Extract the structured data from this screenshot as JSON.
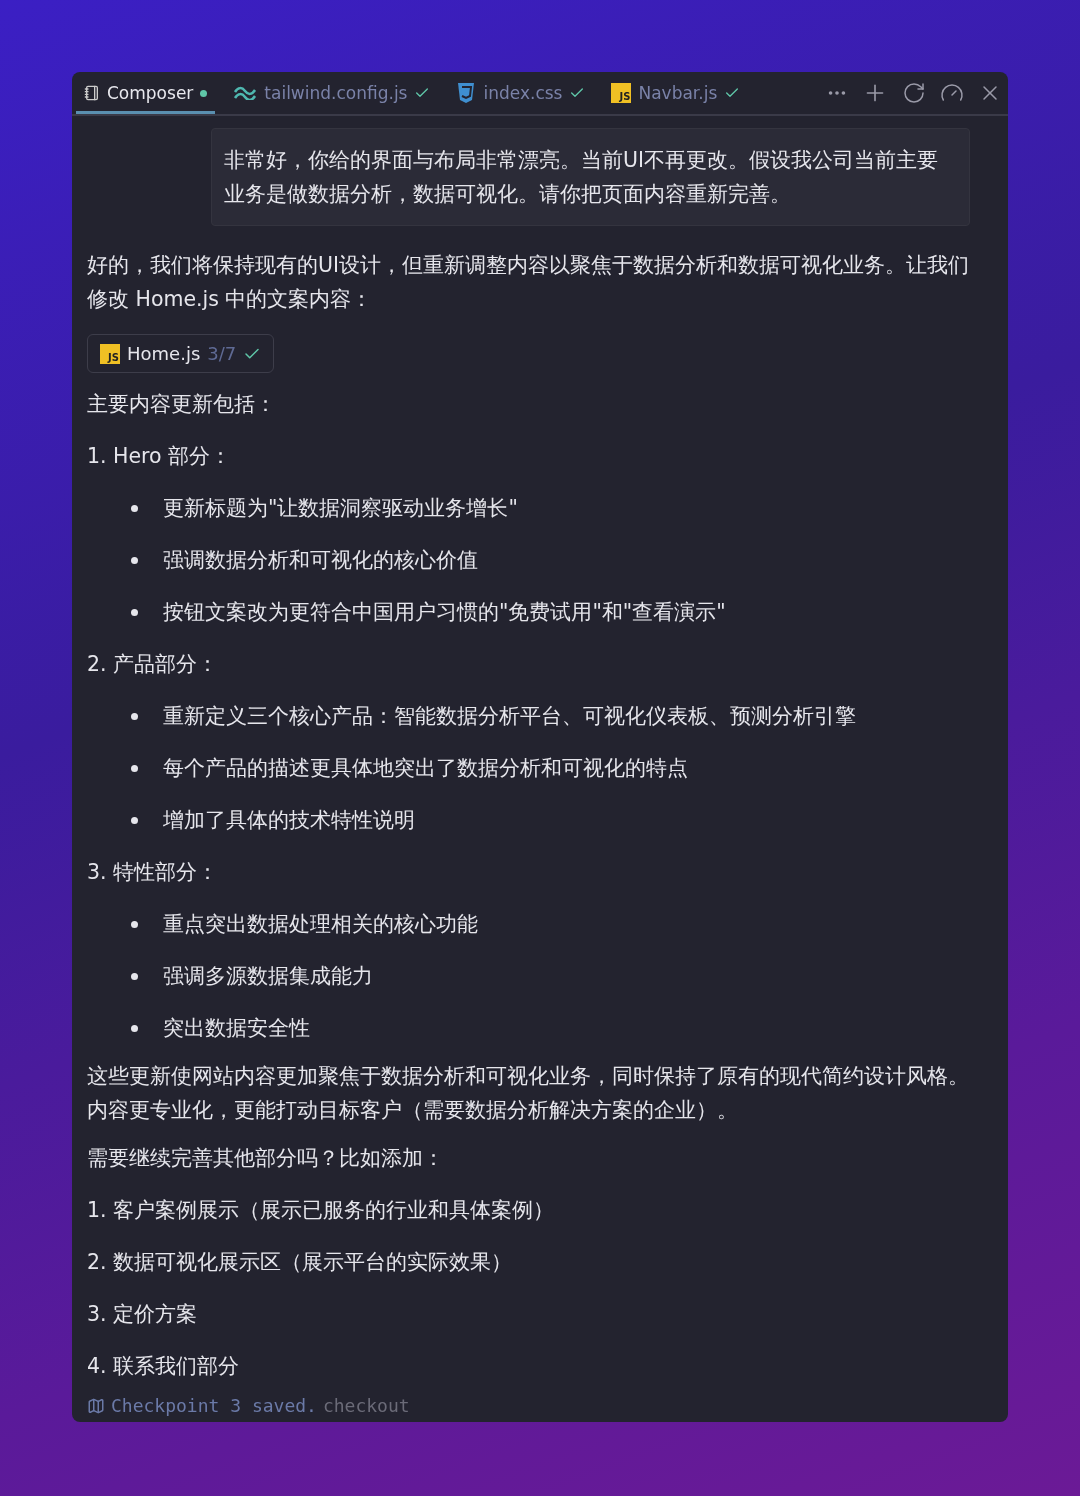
{
  "tabs": [
    {
      "kind": "composer",
      "label": "Composer",
      "selected": true,
      "unsaved": true
    },
    {
      "kind": "tailwind",
      "label": "tailwind.config.js",
      "selected": false,
      "unsaved": false
    },
    {
      "kind": "css",
      "label": "index.css",
      "selected": false,
      "unsaved": false
    },
    {
      "kind": "js",
      "label": "Navbar.js",
      "icon_text": "JS",
      "selected": false,
      "unsaved": false
    }
  ],
  "user_message": "非常好，你给的界面与布局非常漂亮。当前UI不再更改。假设我公司当前主要业务是做数据分析，数据可视化。请你把页面内容重新完善。",
  "reply": [
    {
      "kind": "p",
      "text": "好的，我们将保持现有的UI设计，但重新调整内容以聚焦于数据分析和数据可视化业务。让我们修改 Home.js 中的文案内容："
    },
    {
      "kind": "file",
      "icon_text": "JS",
      "name": "Home.js",
      "count": "3/7"
    },
    {
      "kind": "p",
      "text": "主要内容更新包括："
    },
    {
      "kind": "ol",
      "text": "1. Hero 部分："
    },
    {
      "kind": "li",
      "text": "更新标题为\"让数据洞察驱动业务增长\""
    },
    {
      "kind": "li",
      "text": "强调数据分析和可视化的核心价值"
    },
    {
      "kind": "li",
      "text": "按钮文案改为更符合中国用户习惯的\"免费试用\"和\"查看演示\""
    },
    {
      "kind": "ol",
      "text": "2. 产品部分："
    },
    {
      "kind": "li",
      "text": "重新定义三个核心产品：智能数据分析平台、可视化仪表板、预测分析引擎"
    },
    {
      "kind": "li",
      "text": "每个产品的描述更具体地突出了数据分析和可视化的特点"
    },
    {
      "kind": "li",
      "text": "增加了具体的技术特性说明"
    },
    {
      "kind": "ol",
      "text": "3. 特性部分："
    },
    {
      "kind": "li",
      "text": "重点突出数据处理相关的核心功能"
    },
    {
      "kind": "li",
      "text": "强调多源数据集成能力"
    },
    {
      "kind": "li",
      "text": "突出数据安全性"
    },
    {
      "kind": "p",
      "text": "这些更新使网站内容更加聚焦于数据分析和可视化业务，同时保持了原有的现代简约设计风格。内容更专业化，更能打动目标客户（需要数据分析解决方案的企业）。"
    },
    {
      "kind": "p",
      "text": "需要继续完善其他部分吗？比如添加："
    },
    {
      "kind": "ol",
      "text": "1. 客户案例展示（展示已服务的行业和具体案例）"
    },
    {
      "kind": "ol",
      "text": "2. 数据可视化展示区（展示平台的实际效果）"
    },
    {
      "kind": "ol",
      "text": "3. 定价方案"
    },
    {
      "kind": "ol",
      "text": "4. 联系我们部分"
    }
  ],
  "checkpoint": {
    "text": "Checkpoint 3 saved.",
    "link": "checkout"
  }
}
